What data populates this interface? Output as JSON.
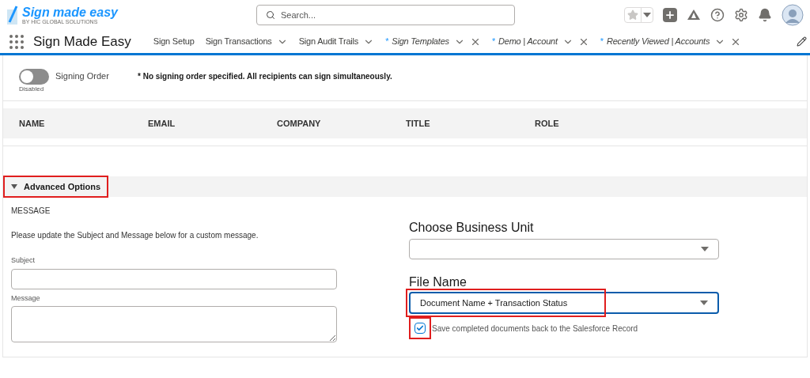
{
  "header": {
    "logo_title": "Sign made easy",
    "logo_subtitle": "BY HIC GLOBAL SOLUTIONS",
    "search": {
      "placeholder": "Search..."
    }
  },
  "nav": {
    "app_name": "Sign Made Easy",
    "tabs": [
      {
        "label": "Sign Setup",
        "kind": "nav",
        "has_menu": false,
        "closable": false
      },
      {
        "label": "Sign Transactions",
        "kind": "nav",
        "has_menu": true,
        "closable": false
      },
      {
        "label": "Sign Audit Trails",
        "kind": "nav",
        "has_menu": true,
        "closable": false
      },
      {
        "marker": "*",
        "label": "Sign Templates",
        "kind": "workspace",
        "has_menu": true,
        "closable": true
      },
      {
        "marker": "*",
        "label": "Demo | Account",
        "kind": "workspace",
        "has_menu": true,
        "closable": true
      },
      {
        "marker": "*",
        "label": "Recently Viewed | Accounts",
        "kind": "workspace",
        "has_menu": true,
        "closable": true
      }
    ]
  },
  "signing_order": {
    "label": "Signing Order",
    "on": false,
    "state_label": "Disabled",
    "note": "* No signing order specified. All recipients can sign simultaneously."
  },
  "table": {
    "columns": [
      "NAME",
      "EMAIL",
      "COMPANY",
      "TITLE",
      "ROLE"
    ]
  },
  "advanced": {
    "title": "Advanced Options",
    "expanded": true,
    "highlighted": true,
    "message": {
      "heading": "MESSAGE",
      "hint": "Please update the Subject and Message below for a custom message.",
      "subject_label": "Subject",
      "message_label": "Message"
    },
    "business_unit": {
      "label": "Choose Business Unit"
    },
    "file_name": {
      "label": "File Name",
      "value": "Document Name + Transaction Status",
      "highlighted": true
    },
    "save_back": {
      "label": "Save completed documents back to the Salesforce Record",
      "checked": true,
      "highlighted": true
    }
  }
}
